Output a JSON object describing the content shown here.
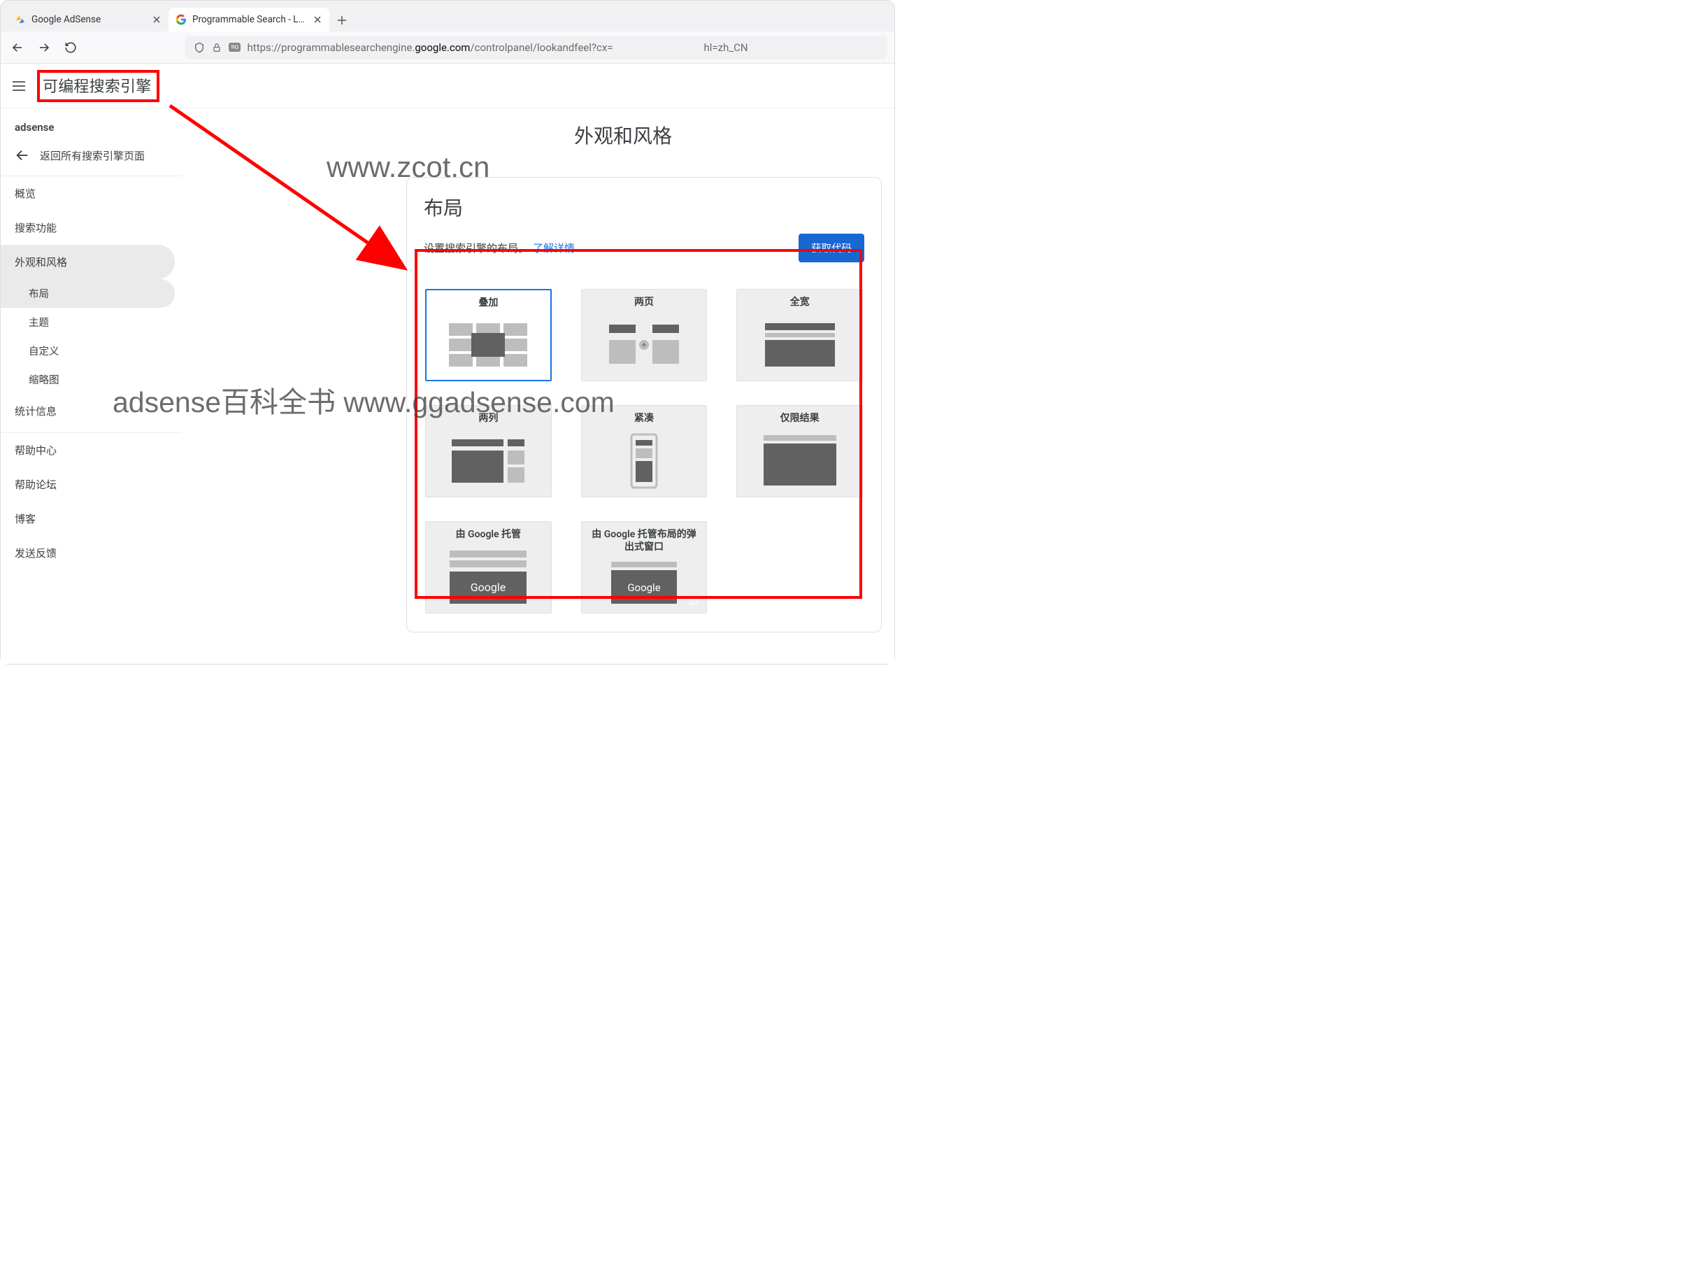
{
  "tabs": [
    {
      "title": "Google AdSense",
      "active": false
    },
    {
      "title": "Programmable Search - Loo",
      "active": true
    }
  ],
  "url": {
    "prefix": "https://programmablesearchengine.",
    "host": "google.com",
    "path_a": "/controlpanel/lookandfeel?cx=",
    "path_b": "hl=zh_CN"
  },
  "app_title": "可编程搜索引擎",
  "sidebar": {
    "engine_label": "adsense",
    "back": "返回所有搜索引擎页面",
    "items": [
      "概览",
      "搜索功能",
      "外观和风格"
    ],
    "subs": [
      "布局",
      "主题",
      "自定义",
      "缩略图"
    ],
    "items2": [
      "统计信息"
    ],
    "help": [
      "帮助中心",
      "帮助论坛",
      "博客",
      "发送反馈"
    ]
  },
  "page": {
    "heading": "外观和风格",
    "section_title": "布局",
    "desc": "设置搜索引擎的布局。",
    "learn_more": "了解详情",
    "get_code": "获取代码",
    "layouts": [
      "叠加",
      "两页",
      "全宽",
      "两列",
      "紧凑",
      "仅限结果",
      "由 Google 托管",
      "由 Google 托管布局的弹出式窗口"
    ]
  },
  "watermarks": {
    "wm1": "www.zcot.cn",
    "wm2": "adsense百科全书 www.ggadsense.com"
  }
}
